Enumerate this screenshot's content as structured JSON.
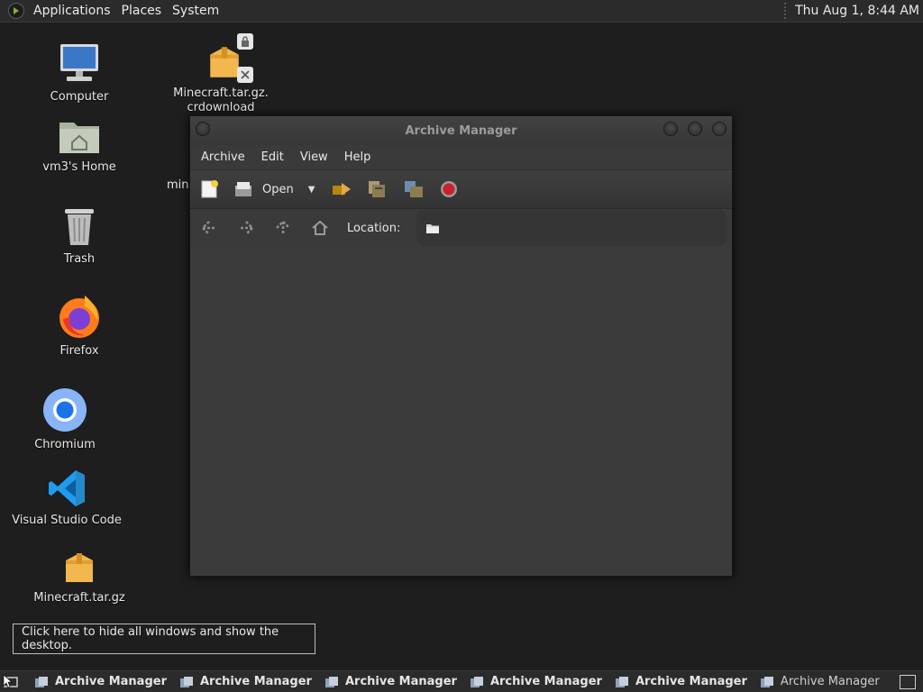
{
  "top_panel": {
    "menus": [
      "Applications",
      "Places",
      "System"
    ],
    "clock": "Thu Aug  1,  8:44 AM"
  },
  "desktop": {
    "icons": [
      {
        "label": "Computer",
        "icon": "computer-icon"
      },
      {
        "label": "vm3's Home",
        "icon": "home-folder-icon"
      },
      {
        "label": "Trash",
        "icon": "trash-icon"
      },
      {
        "label": "Firefox",
        "icon": "firefox-icon"
      },
      {
        "label": "Chromium",
        "icon": "chromium-icon"
      },
      {
        "label": "Visual Studio Code",
        "icon": "vscode-icon"
      },
      {
        "label": "Minecraft.tar.gz",
        "icon": "archive-icon"
      }
    ],
    "download": {
      "label_line1": "Minecraft.tar.gz.",
      "label_line2": "crdownload",
      "icon": "archive-icon"
    },
    "partial_label": "min"
  },
  "window": {
    "title": "Archive Manager",
    "menu": [
      "Archive",
      "Edit",
      "View",
      "Help"
    ],
    "toolbar": {
      "open_label": "Open"
    },
    "location_label": "Location:"
  },
  "tooltip": "Click here to hide all windows and show the desktop.",
  "taskbar": {
    "tasks": [
      "Archive Manager",
      "Archive Manager",
      "Archive Manager",
      "Archive Manager",
      "Archive Manager",
      "Archive Manager"
    ]
  },
  "colors": {
    "desktop_bg": "#1e1e1e",
    "panel_bg": "#2b2b2b",
    "window_bg": "#3b3b3b"
  }
}
